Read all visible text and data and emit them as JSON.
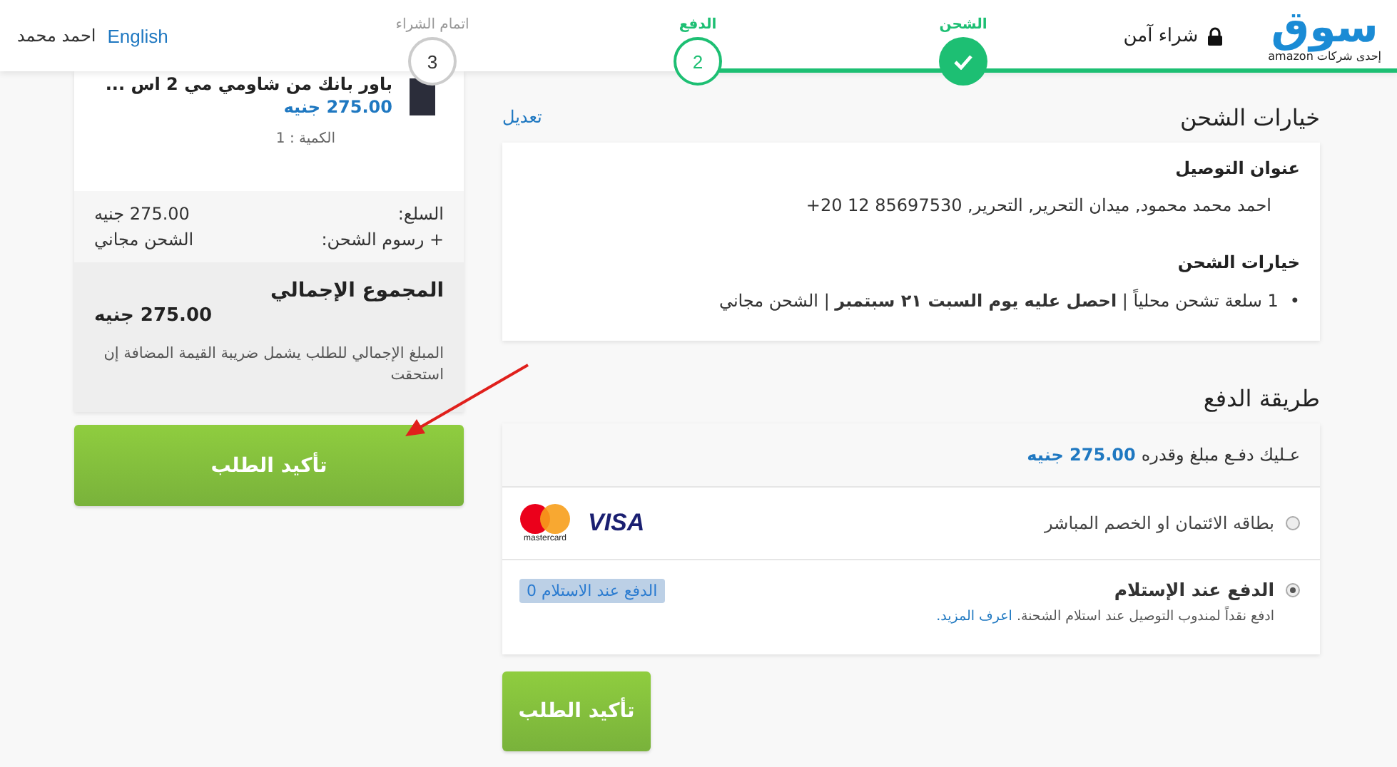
{
  "header": {
    "logo": {
      "text": "سوق",
      "tagline": "إحدى شركات amazon"
    },
    "secure_label": "شراء آمن",
    "language_link": "English",
    "user_name": "احمد محمد"
  },
  "steps": [
    {
      "label": "الشحن",
      "completed": true,
      "selected": false
    },
    {
      "label": "الدفع",
      "number": "2",
      "completed": false,
      "selected": true
    },
    {
      "label": "اتمام الشراء",
      "number": "3",
      "completed": false,
      "selected": false
    }
  ],
  "summary": {
    "product": {
      "title": "باور بانك من شاومي مي 2 اس ...",
      "price": "275.00 جنيه",
      "quantity": "الكمية : 1"
    },
    "lines": [
      {
        "label": "السلع:",
        "value": "275.00 جنيه"
      },
      {
        "label": "+  رسوم الشحن:",
        "value": "الشحن مجاني"
      }
    ],
    "total_label": "المجموع الإجمالي",
    "total_value": "275.00 جنيه",
    "total_note": "المبلغ الإجمالي للطلب يشمل ضريبة القيمة المضافة إن استحقت",
    "confirm_button": "تأكيد الطلب"
  },
  "shipping": {
    "title": "خيارات الشحن",
    "edit_link": "تعديل",
    "address_title": "عنوان التوصيل",
    "address": "احمد محمد محمود,  ميدان التحرير,  التحرير,  85697530 12 20+",
    "options_title": "خيارات الشحن",
    "options": [
      {
        "bullet": "•",
        "text": "1 سلعة تشحن محلياً | **احصل عليه يوم السبت ٢١ سبتمبر** | الشحن مجاني"
      }
    ]
  },
  "payment": {
    "title": "طريقة الدفع",
    "amount_text": "عـليك دفـع مبلغ وقدره **275.00 جنيه**",
    "methods": [
      {
        "kind": "card",
        "label": "بطاقه الائتمان او الخصم المباشر",
        "selected": false,
        "logos": [
          "VISA",
          "mastercard"
        ]
      },
      {
        "kind": "cod",
        "label": "الدفع عند الإستلام",
        "selected": true,
        "badge": "الدفع عند الاستلام 0",
        "description": "ادفع نقداً لمندوب التوصيل عند استلام الشحنة.",
        "link": "اعرف المزيد."
      }
    ],
    "confirm_button": "تأكيد الطلب"
  },
  "annotation": {
    "kind": "arrow"
  }
}
